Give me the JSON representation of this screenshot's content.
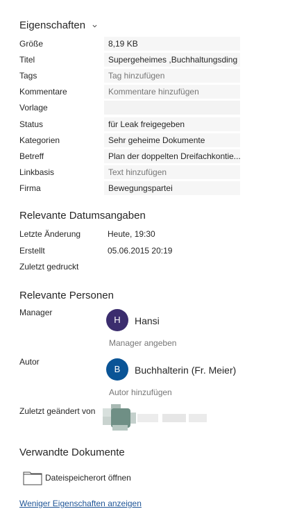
{
  "properties": {
    "title": "Eigenschaften",
    "rows": [
      {
        "label": "Größe",
        "value": "8,19 KB",
        "placeholder": false
      },
      {
        "label": "Titel",
        "value": "Supergeheimes ,Buchhaltungsding",
        "placeholder": false
      },
      {
        "label": "Tags",
        "value": "Tag hinzufügen",
        "placeholder": true
      },
      {
        "label": "Kommentare",
        "value": "Kommentare hinzufügen",
        "placeholder": true
      },
      {
        "label": "Vorlage",
        "value": "",
        "placeholder": false
      },
      {
        "label": "Status",
        "value": "für Leak freigegeben",
        "placeholder": false
      },
      {
        "label": "Kategorien",
        "value": "Sehr geheime Dokumente",
        "placeholder": false
      },
      {
        "label": "Betreff",
        "value": "Plan der doppelten Dreifachkontie...",
        "placeholder": false
      },
      {
        "label": "Linkbasis",
        "value": "Text hinzufügen",
        "placeholder": true
      },
      {
        "label": "Firma",
        "value": "Bewegungspartei",
        "placeholder": false
      }
    ]
  },
  "dates": {
    "title": "Relevante Datumsangaben",
    "rows": [
      {
        "label": "Letzte Änderung",
        "value": "Heute, 19:30"
      },
      {
        "label": "Erstellt",
        "value": "05.06.2015 20:19"
      },
      {
        "label": "Zuletzt gedruckt",
        "value": ""
      }
    ]
  },
  "people": {
    "title": "Relevante Personen",
    "manager": {
      "label": "Manager",
      "initial": "H",
      "name": "Hansi",
      "avatar_color": "#3b2d6e",
      "add_label": "Manager angeben"
    },
    "author": {
      "label": "Autor",
      "initial": "B",
      "name": "Buchhalterin (Fr. Meier)",
      "avatar_color": "#0a5496",
      "add_label": "Autor hinzufügen"
    },
    "last_modified": {
      "label": "Zuletzt geändert von"
    }
  },
  "related": {
    "title": "Verwandte Dokumente",
    "open_location": "Dateispeicherort öffnen",
    "icon": "folder-icon"
  },
  "footer": {
    "less_properties_link": "Weniger Eigenschaften anzeigen"
  },
  "colors": {
    "link": "#1f5597",
    "field_bg": "#f6f6f6",
    "placeholder": "#767676"
  }
}
